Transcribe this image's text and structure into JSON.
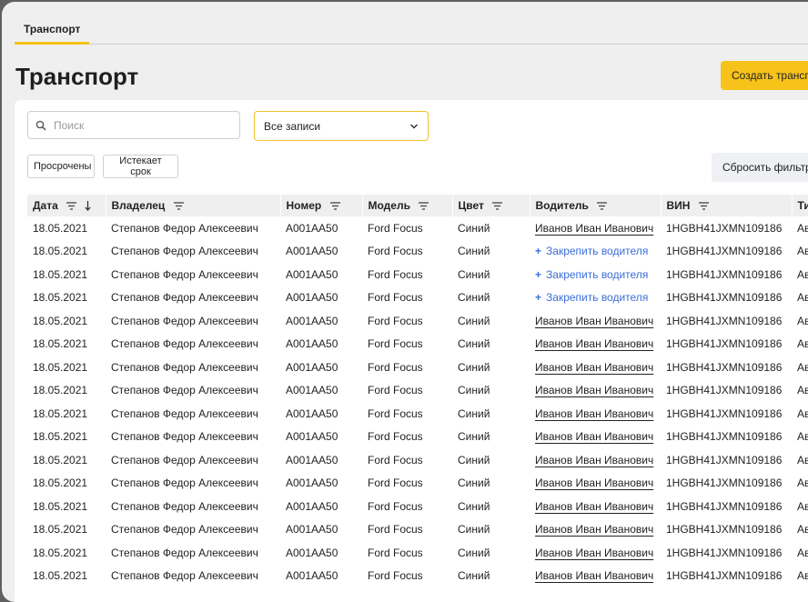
{
  "tabs": [
    {
      "label": "Транспорт"
    }
  ],
  "page": {
    "title": "Транспорт",
    "create_label": "Создать трансп"
  },
  "filters": {
    "search_placeholder": "Поиск",
    "select_value": "Все записи",
    "chips": [
      "Просрочены",
      "Истекает срок"
    ],
    "reset_label": "Сбросить фильтр"
  },
  "colors": {
    "accent": "#f7c21a",
    "link": "#3a6fd8",
    "header_bg": "#efefef"
  },
  "table": {
    "columns": [
      "Дата",
      "Владелец",
      "Номер",
      "Модель",
      "Цвет",
      "Водитель",
      "ВИН",
      "Ти"
    ],
    "attach_label": "Закрепить водителя",
    "rows": [
      {
        "date": "18.05.2021",
        "owner": "Степанов Федор Алексеевич",
        "number": "A001AA50",
        "model": "Ford Focus",
        "color": "Синий",
        "driver": "Иванов Иван Иванович",
        "vin": "1HGBH41JXMN109186",
        "type": "Ав"
      },
      {
        "date": "18.05.2021",
        "owner": "Степанов Федор Алексеевич",
        "number": "A001AA50",
        "model": "Ford Focus",
        "color": "Синий",
        "driver": null,
        "vin": "1HGBH41JXMN109186",
        "type": "Ав"
      },
      {
        "date": "18.05.2021",
        "owner": "Степанов Федор Алексеевич",
        "number": "A001AA50",
        "model": "Ford Focus",
        "color": "Синий",
        "driver": null,
        "vin": "1HGBH41JXMN109186",
        "type": "Ав"
      },
      {
        "date": "18.05.2021",
        "owner": "Степанов Федор Алексеевич",
        "number": "A001AA50",
        "model": "Ford Focus",
        "color": "Синий",
        "driver": null,
        "vin": "1HGBH41JXMN109186",
        "type": "Ав"
      },
      {
        "date": "18.05.2021",
        "owner": "Степанов Федор Алексеевич",
        "number": "A001AA50",
        "model": "Ford Focus",
        "color": "Синий",
        "driver": "Иванов Иван Иванович",
        "vin": "1HGBH41JXMN109186",
        "type": "Ав"
      },
      {
        "date": "18.05.2021",
        "owner": "Степанов Федор Алексеевич",
        "number": "A001AA50",
        "model": "Ford Focus",
        "color": "Синий",
        "driver": "Иванов Иван Иванович",
        "vin": "1HGBH41JXMN109186",
        "type": "Ав"
      },
      {
        "date": "18.05.2021",
        "owner": "Степанов Федор Алексеевич",
        "number": "A001AA50",
        "model": "Ford Focus",
        "color": "Синий",
        "driver": "Иванов Иван Иванович",
        "vin": "1HGBH41JXMN109186",
        "type": "Ав"
      },
      {
        "date": "18.05.2021",
        "owner": "Степанов Федор Алексеевич",
        "number": "A001AA50",
        "model": "Ford Focus",
        "color": "Синий",
        "driver": "Иванов Иван Иванович",
        "vin": "1HGBH41JXMN109186",
        "type": "Ав"
      },
      {
        "date": "18.05.2021",
        "owner": "Степанов Федор Алексеевич",
        "number": "A001AA50",
        "model": "Ford Focus",
        "color": "Синий",
        "driver": "Иванов Иван Иванович",
        "vin": "1HGBH41JXMN109186",
        "type": "Ав"
      },
      {
        "date": "18.05.2021",
        "owner": "Степанов Федор Алексеевич",
        "number": "A001AA50",
        "model": "Ford Focus",
        "color": "Синий",
        "driver": "Иванов Иван Иванович",
        "vin": "1HGBH41JXMN109186",
        "type": "Ав"
      },
      {
        "date": "18.05.2021",
        "owner": "Степанов Федор Алексеевич",
        "number": "A001AA50",
        "model": "Ford Focus",
        "color": "Синий",
        "driver": "Иванов Иван Иванович",
        "vin": "1HGBH41JXMN109186",
        "type": "Ав"
      },
      {
        "date": "18.05.2021",
        "owner": "Степанов Федор Алексеевич",
        "number": "A001AA50",
        "model": "Ford Focus",
        "color": "Синий",
        "driver": "Иванов Иван Иванович",
        "vin": "1HGBH41JXMN109186",
        "type": "Ав"
      },
      {
        "date": "18.05.2021",
        "owner": "Степанов Федор Алексеевич",
        "number": "A001AA50",
        "model": "Ford Focus",
        "color": "Синий",
        "driver": "Иванов Иван Иванович",
        "vin": "1HGBH41JXMN109186",
        "type": "Ав"
      },
      {
        "date": "18.05.2021",
        "owner": "Степанов Федор Алексеевич",
        "number": "A001AA50",
        "model": "Ford Focus",
        "color": "Синий",
        "driver": "Иванов Иван Иванович",
        "vin": "1HGBH41JXMN109186",
        "type": "Ав"
      },
      {
        "date": "18.05.2021",
        "owner": "Степанов Федор Алексеевич",
        "number": "A001AA50",
        "model": "Ford Focus",
        "color": "Синий",
        "driver": "Иванов Иван Иванович",
        "vin": "1HGBH41JXMN109186",
        "type": "Ав"
      },
      {
        "date": "18.05.2021",
        "owner": "Степанов Федор Алексеевич",
        "number": "A001AA50",
        "model": "Ford Focus",
        "color": "Синий",
        "driver": "Иванов Иван Иванович",
        "vin": "1HGBH41JXMN109186",
        "type": "Ав"
      }
    ]
  }
}
